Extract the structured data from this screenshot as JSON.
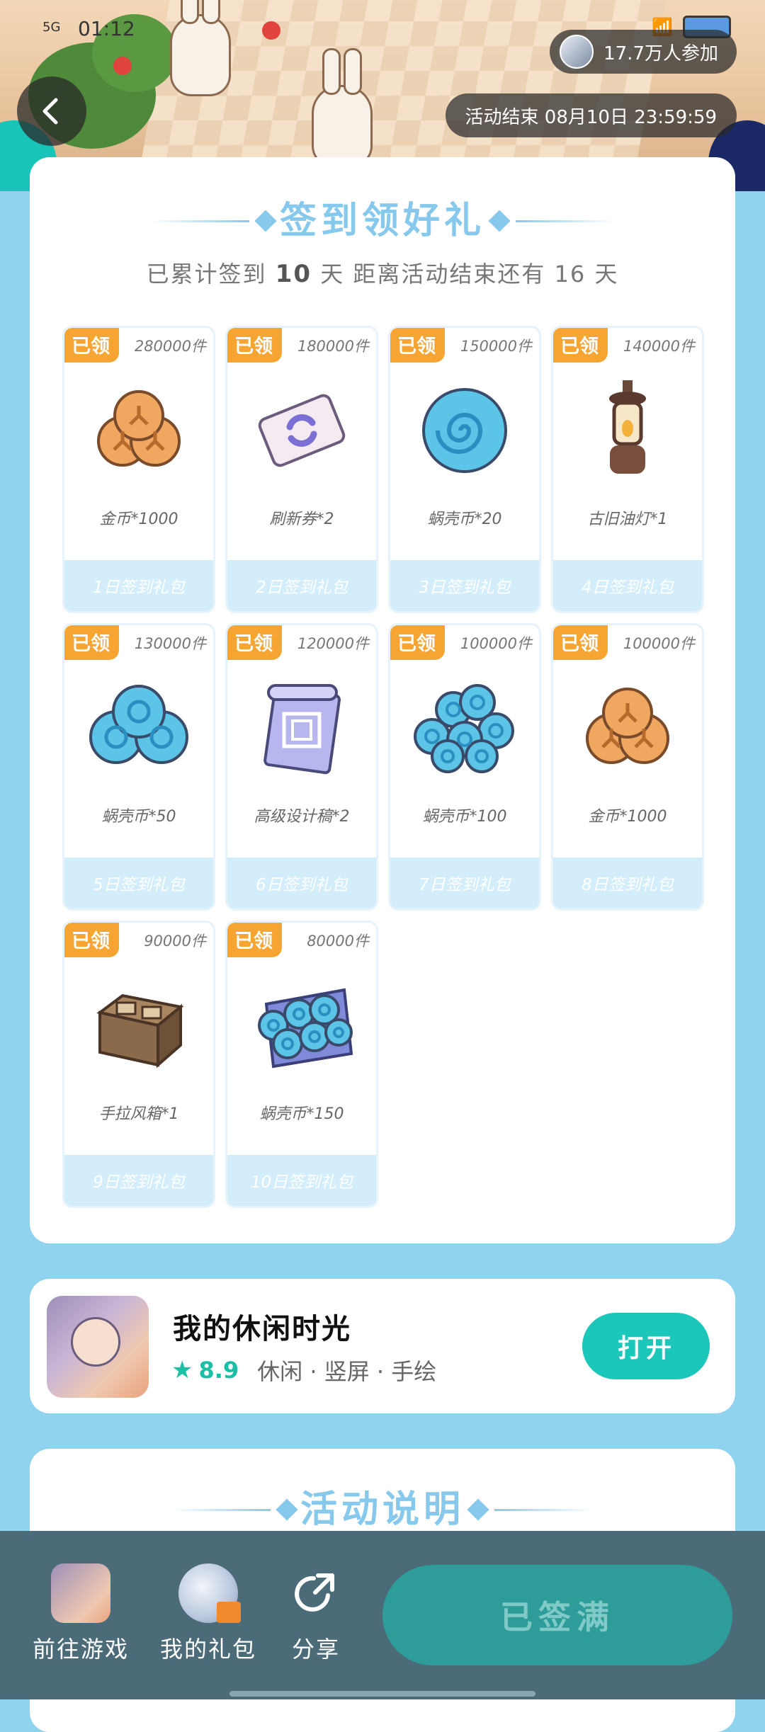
{
  "status_bar": {
    "network": "5G",
    "time": "01:12"
  },
  "header": {
    "participants": "17.7万人参加",
    "end_time": "活动结束 08月10日 23:59:59"
  },
  "signin": {
    "title": "签到领好礼",
    "summary": {
      "prefix": "已累计签到",
      "days": "10",
      "middle": "天  距离活动结束还有",
      "remaining": "16",
      "suffix": "天"
    },
    "gifts": [
      {
        "badge": "已领",
        "quantity": "280000件",
        "reward": "金币*1000",
        "pack": "1日签到礼包",
        "icon": "gold-coin-icon"
      },
      {
        "badge": "已领",
        "quantity": "180000件",
        "reward": "刷新券*2",
        "pack": "2日签到礼包",
        "icon": "refresh-ticket-icon"
      },
      {
        "badge": "已领",
        "quantity": "150000件",
        "reward": "蜗壳币*20",
        "pack": "3日签到礼包",
        "icon": "shell-coin-icon"
      },
      {
        "badge": "已领",
        "quantity": "140000件",
        "reward": "古旧油灯*1",
        "pack": "4日签到礼包",
        "icon": "oil-lamp-icon"
      },
      {
        "badge": "已领",
        "quantity": "130000件",
        "reward": "蜗壳币*50",
        "pack": "5日签到礼包",
        "icon": "shell-coins-icon"
      },
      {
        "badge": "已领",
        "quantity": "120000件",
        "reward": "高级设计稿*2",
        "pack": "6日签到礼包",
        "icon": "blueprint-icon"
      },
      {
        "badge": "已领",
        "quantity": "100000件",
        "reward": "蜗壳币*100",
        "pack": "7日签到礼包",
        "icon": "shell-coins-pile-icon"
      },
      {
        "badge": "已领",
        "quantity": "100000件",
        "reward": "金币*1000",
        "pack": "8日签到礼包",
        "icon": "gold-coin-icon"
      },
      {
        "badge": "已领",
        "quantity": "90000件",
        "reward": "手拉风箱*1",
        "pack": "9日签到礼包",
        "icon": "bellows-icon"
      },
      {
        "badge": "已领",
        "quantity": "80000件",
        "reward": "蜗壳币*150",
        "pack": "10日签到礼包",
        "icon": "shell-coins-bag-icon"
      }
    ]
  },
  "app": {
    "name": "我的休闲时光",
    "rating": "8.9",
    "tags": "休闲 · 竖屏 · 手绘",
    "open_label": "打开"
  },
  "rules": {
    "title": "活动说明"
  },
  "bottom_bar": {
    "game_label": "前往游戏",
    "gift_label": "我的礼包",
    "share_label": "分享",
    "signed_label": "已签满"
  },
  "colors": {
    "accent": "#1ac7b9",
    "badge": "#f7a532",
    "title_blue": "#86c9ec",
    "page_bg": "#8fd3ee",
    "bottom_bar": "#4b6b79"
  }
}
